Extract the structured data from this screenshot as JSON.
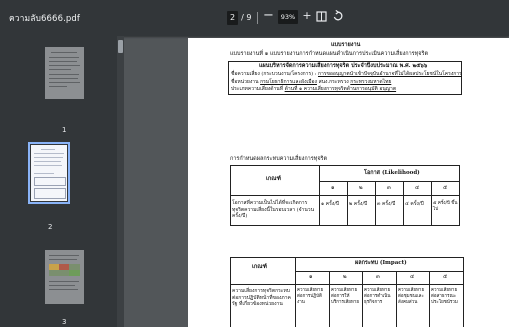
{
  "toolbar": {
    "file_name": "ความลับ6666.pdf",
    "current_page": "2",
    "page_total": "/ 9",
    "zoom_out": "−",
    "zoom_value": "93%",
    "zoom_in": "+",
    "fit_icon": "fit-page-icon",
    "rotate_icon": "rotate-icon"
  },
  "sidebar": {
    "thumbnails": [
      {
        "label": "1"
      },
      {
        "label": "2",
        "selected": true
      },
      {
        "label": "3"
      }
    ]
  },
  "document": {
    "heading": "แบบรายงาน",
    "report_line": "แบบรายงานที่ ๑ แบบรายงานการกำหนดแผนดำเนินการประเมินความเสี่ยงการทุจริต",
    "form_title": "แผนบริหารจัดการความเสี่ยงการทุจริต ประจำปีงบประมาณ พ.ศ. ๒๕๖๖",
    "risk_prefix": "ชื่อความเสี่ยง (กระบวนงาน/โครงการ) :",
    "risk_value": "การขออนุญาตนำเข้าปัจจุบันอำนาจที่ไม่ได้ผลประโยชน์ในโครงการ",
    "dept_label": "ชื่อหน่วยงาน",
    "dept_value": "กรมโยธาธิการและผังเมือง",
    "sub_label": "สนง.กระทรวง",
    "sub_value": "กระทรวงมหาดไทย",
    "type_prefix": "ประเภทความเสี่ยงด้านที่",
    "type_value": "ด้านที่ ๑ ความเสี่ยงการทุจริตด้านการอนุมัติ อนุญาต",
    "section_title": "การกำหนดผลกระทบความเสี่ยงการทุจริต",
    "table1": {
      "col_event": "เกณฑ์",
      "col_likelihood": "โอกาส (Likelihood)",
      "levels": [
        "๑",
        "๒",
        "๓",
        "๔",
        "๕"
      ],
      "row_label": "โอกาสที่ความเป็นไปได้ที่จะเกิดการทุจริตความเสี่ยงนี้ในรอบเวลา (จำนวนครั้ง/ปี)",
      "cells": [
        "๑ ครั้ง/ปี",
        "๒ ครั้ง/ปี",
        "๓ ครั้ง/ปี",
        "๔ ครั้ง/ปี",
        "๕ ครั้ง/ปี ขึ้นไป"
      ]
    },
    "table2": {
      "col_event": "เกณฑ์",
      "col_impact": "ผลกระทบ (Impact)",
      "levels": [
        "๑",
        "๒",
        "๓",
        "๔",
        "๕"
      ],
      "row_label": "ความเสี่ยงการทุจริตกระทบต่อการปฏิบัติหน้าที่ของภาครัฐ ที่เกี่ยวข้องหน่วยงาน",
      "cells": [
        "ความเสียหายต่อการปฏิบัติงาน",
        "ความเสียหายต่อการให้บริการเสียหาย",
        "ความเสียหายต่อการดำเนินธุรกิจการ",
        "ความเสียหายต่อชุมชนและสังคมส่วน",
        "ความเสียหายต่อสาธารณะประโยชน์รวม"
      ]
    }
  }
}
